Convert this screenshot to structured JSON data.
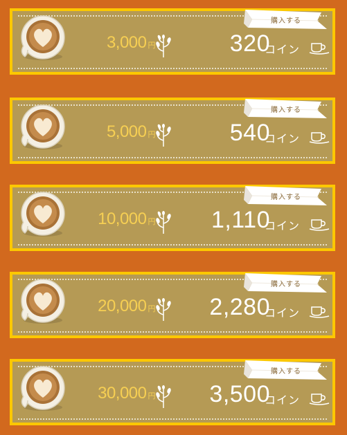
{
  "colors": {
    "page_background": "#d2691e",
    "card_border": "#fcc800",
    "card_background": "#b59a55",
    "price_text": "#f6cf53",
    "coin_text": "#ffffff"
  },
  "icons": {
    "cup": "latte-heart-cup-icon",
    "sprig": "leaf-sprig-icon",
    "saucer": "coffee-cup-saucer-icon"
  },
  "plans": [
    {
      "price": "3,000",
      "yen": "円",
      "coins": "320",
      "coin_unit": "コイン",
      "buy_label": "購入する"
    },
    {
      "price": "5,000",
      "yen": "円",
      "coins": "540",
      "coin_unit": "コイン",
      "buy_label": "購入する"
    },
    {
      "price": "10,000",
      "yen": "円",
      "coins": "1,110",
      "coin_unit": "コイン",
      "buy_label": "購入する"
    },
    {
      "price": "20,000",
      "yen": "円",
      "coins": "2,280",
      "coin_unit": "コイン",
      "buy_label": "購入する"
    },
    {
      "price": "30,000",
      "yen": "円",
      "coins": "3,500",
      "coin_unit": "コイン",
      "buy_label": "購入する"
    }
  ]
}
